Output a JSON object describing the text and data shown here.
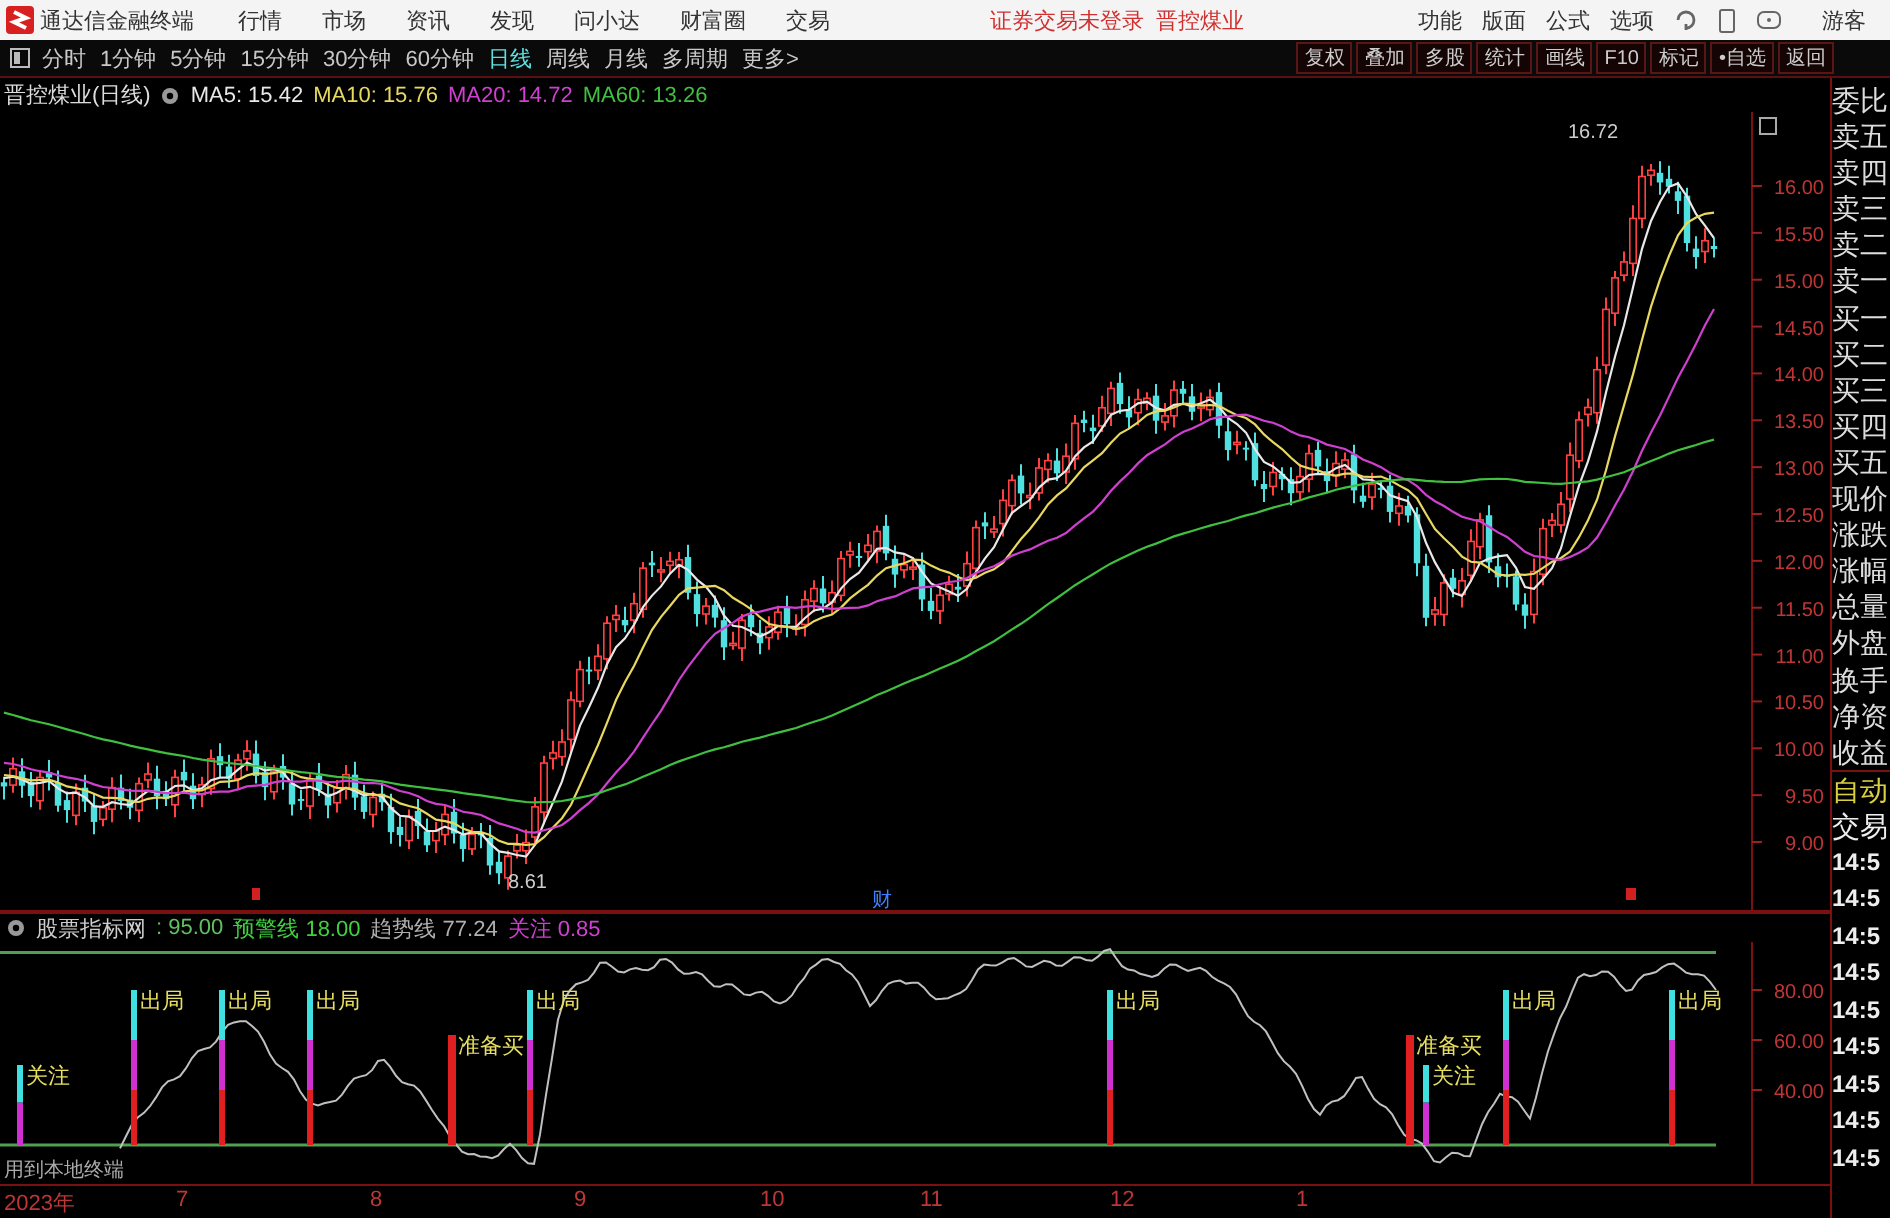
{
  "menu_bar": {
    "app_title": "通达信金融终端",
    "menus": [
      "行情",
      "市场",
      "资讯",
      "发现",
      "问小达",
      "财富圈",
      "交易"
    ],
    "notice": [
      "证券交易未登录",
      "晋控煤业"
    ],
    "right_menus": [
      "功能",
      "版面",
      "公式",
      "选项"
    ],
    "user": "游客"
  },
  "toolbar": {
    "periods": [
      {
        "label": "分时",
        "selected": false
      },
      {
        "label": "1分钟",
        "selected": false
      },
      {
        "label": "5分钟",
        "selected": false
      },
      {
        "label": "15分钟",
        "selected": false
      },
      {
        "label": "30分钟",
        "selected": false
      },
      {
        "label": "60分钟",
        "selected": false
      },
      {
        "label": "日线",
        "selected": true
      },
      {
        "label": "周线",
        "selected": false
      },
      {
        "label": "月线",
        "selected": false
      },
      {
        "label": "多周期",
        "selected": false
      },
      {
        "label": "更多>",
        "selected": false
      }
    ],
    "tools": [
      "复权",
      "叠加",
      "多股",
      "统计",
      "画线",
      "F10",
      "标记",
      "•自选",
      "返回"
    ]
  },
  "main_chart": {
    "title": "晋控煤业(日线)",
    "moving_averages": [
      {
        "label": "MA5: 15.42",
        "color": "#e8e8e8"
      },
      {
        "label": "MA10: 15.76",
        "color": "#e8d860"
      },
      {
        "label": "MA20: 14.72",
        "color": "#d040d0"
      },
      {
        "label": "MA60: 13.26",
        "color": "#40c040"
      }
    ],
    "price_axis": [
      "16.00",
      "15.50",
      "15.00",
      "14.50",
      "14.00",
      "13.50",
      "13.00",
      "12.50",
      "12.00",
      "11.50",
      "11.00",
      "10.50",
      "10.00",
      "9.50",
      "9.00"
    ],
    "high_label": "16.72",
    "low_label": "8.61",
    "event_labels": [
      "财"
    ]
  },
  "indicator": {
    "name": "股票指标网",
    "readings": [
      {
        "label": ": 95.00",
        "color": "#60c060"
      },
      {
        "label": "预警线 18.00",
        "color": "#40d040"
      },
      {
        "label": "趋势线 77.24",
        "color": "#b0b0b0"
      },
      {
        "label": "关注 0.85",
        "color": "#d040d0"
      }
    ],
    "axis": [
      "80.00",
      "60.00",
      "40.00"
    ],
    "signals": [
      {
        "label": "关注",
        "kind": "watch"
      },
      {
        "label": "出局",
        "kind": "exit"
      },
      {
        "label": "出局",
        "kind": "exit"
      },
      {
        "label": "出局",
        "kind": "exit"
      },
      {
        "label": "准备买",
        "kind": "prepare"
      },
      {
        "label": "出局",
        "kind": "exit"
      },
      {
        "label": "出局",
        "kind": "exit"
      },
      {
        "label": "准备买",
        "kind": "prepare"
      },
      {
        "label": "关注",
        "kind": "watch"
      },
      {
        "label": "出局",
        "kind": "exit"
      },
      {
        "label": "出局",
        "kind": "exit"
      }
    ],
    "note": "用到本地终端"
  },
  "date_axis": [
    "2023年",
    "7",
    "8",
    "9",
    "10",
    "11",
    "12",
    "1"
  ],
  "sidebar": {
    "labels": [
      {
        "label": "委比",
        "kind": "field"
      },
      {
        "label": "卖五",
        "kind": "field"
      },
      {
        "label": "卖四",
        "kind": "field"
      },
      {
        "label": "卖三",
        "kind": "field"
      },
      {
        "label": "卖二",
        "kind": "field"
      },
      {
        "label": "卖一",
        "kind": "field"
      },
      {
        "label": "买一",
        "kind": "field"
      },
      {
        "label": "买二",
        "kind": "field"
      },
      {
        "label": "买三",
        "kind": "field"
      },
      {
        "label": "买四",
        "kind": "field"
      },
      {
        "label": "买五",
        "kind": "field"
      },
      {
        "label": "现价",
        "kind": "field"
      },
      {
        "label": "涨跌",
        "kind": "field"
      },
      {
        "label": "涨幅",
        "kind": "field"
      },
      {
        "label": "总量",
        "kind": "field"
      },
      {
        "label": "外盘",
        "kind": "field"
      },
      {
        "label": "换手",
        "kind": "field"
      },
      {
        "label": "净资",
        "kind": "field"
      },
      {
        "label": "收益",
        "kind": "field"
      },
      {
        "label": "自动",
        "kind": "toggle"
      },
      {
        "label": "交易",
        "kind": "button"
      }
    ],
    "times": [
      "14:5",
      "14:5",
      "14:5",
      "14:5",
      "14:5",
      "14:5",
      "14:5",
      "14:5",
      "14:5"
    ]
  }
}
